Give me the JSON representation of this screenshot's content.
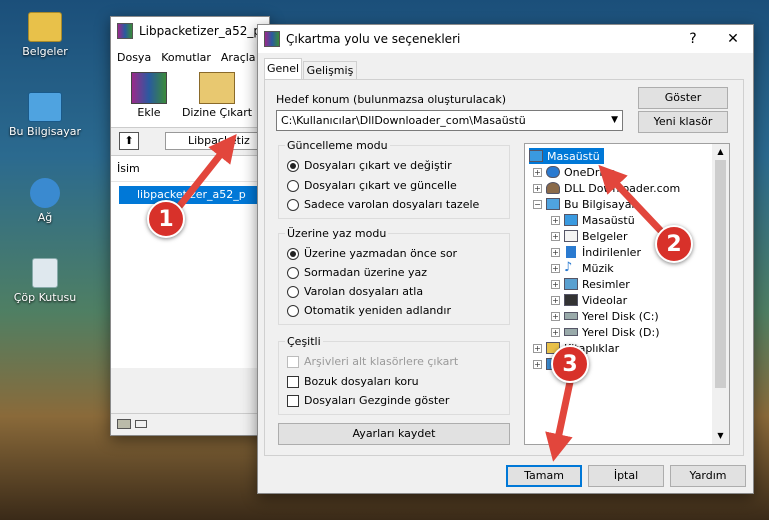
{
  "desktop": {
    "icons": [
      {
        "label": "Belgeler"
      },
      {
        "label": "Bu Bilgisayar"
      },
      {
        "label": "Ağ"
      },
      {
        "label": "Çöp Kutusu"
      }
    ]
  },
  "bg_window": {
    "title": "Libpacketizer_a52_p",
    "menu": [
      "Dosya",
      "Komutlar",
      "Araçla"
    ],
    "tools": [
      {
        "label": "Ekle"
      },
      {
        "label": "Dizine Çıkart"
      }
    ],
    "path_text": "Libpacketiz",
    "column": "İsim",
    "file": "libpacketizer_a52_p"
  },
  "dialog": {
    "title": "Çıkartma yolu ve seçenekleri",
    "help_label": "?",
    "close_label": "✕",
    "tabs": [
      "Genel",
      "Gelişmiş"
    ],
    "dest_label": "Hedef konum (bulunmazsa oluşturulacak)",
    "dest_value": "C:\\Kullanıcılar\\DllDownloader_com\\Masaüstü",
    "show_button": "Göster",
    "new_folder_button": "Yeni klasör",
    "update_mode": {
      "label": "Güncelleme modu",
      "options": [
        "Dosyaları çıkart ve değiştir",
        "Dosyaları çıkart ve güncelle",
        "Sadece varolan dosyaları tazele"
      ],
      "selected": 0
    },
    "overwrite_mode": {
      "label": "Üzerine yaz modu",
      "options": [
        "Üzerine yazmadan önce sor",
        "Sormadan üzerine yaz",
        "Varolan dosyaları atla",
        "Otomatik yeniden adlandır"
      ],
      "selected": 0
    },
    "misc": {
      "label": "Çeşitli",
      "options": [
        "Arşivleri alt klasörlere çıkart",
        "Bozuk dosyaları koru",
        "Dosyaları Gezginde göster"
      ]
    },
    "save_settings": "Ayarları kaydet",
    "tree": [
      {
        "label": "Masaüstü",
        "level": 0
      },
      {
        "label": "OneDrive",
        "level": 1
      },
      {
        "label": "DLL Downloader.com",
        "level": 1
      },
      {
        "label": "Bu Bilgisayar",
        "level": 1
      },
      {
        "label": "Masaüstü",
        "level": 2
      },
      {
        "label": "Belgeler",
        "level": 2
      },
      {
        "label": "İndirilenler",
        "level": 2
      },
      {
        "label": "Müzik",
        "level": 2
      },
      {
        "label": "Resimler",
        "level": 2
      },
      {
        "label": "Videolar",
        "level": 2
      },
      {
        "label": "Yerel Disk (C:)",
        "level": 2
      },
      {
        "label": "Yerel Disk (D:)",
        "level": 2
      },
      {
        "label": "Kitaplıklar",
        "level": 1
      },
      {
        "label": "Ağ",
        "level": 1
      }
    ],
    "ok_button": "Tamam",
    "cancel_button": "İptal",
    "help_button": "Yardım"
  },
  "markers": [
    "1",
    "2",
    "3"
  ],
  "colors": {
    "selection": "#0078d7",
    "marker": "#d8312a",
    "arrow": "#e2463c"
  }
}
